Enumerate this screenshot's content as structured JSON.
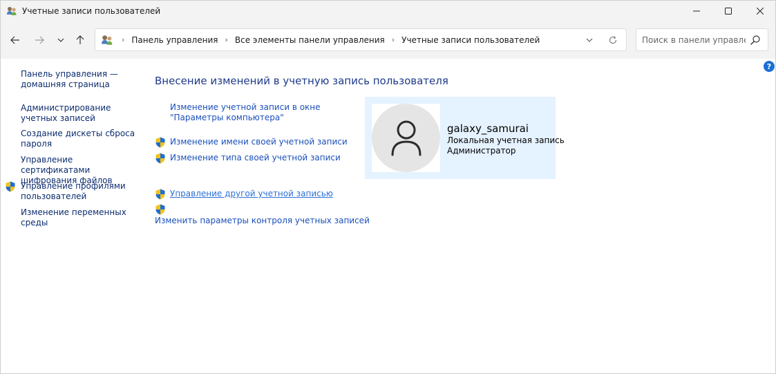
{
  "window": {
    "title": "Учетные записи пользователей"
  },
  "address_bar": {
    "crumbs": [
      "Панель управления",
      "Все элементы панели управления",
      "Учетные записи пользователей"
    ]
  },
  "search": {
    "placeholder": "Поиск в панели управле..."
  },
  "help": {
    "label": "?"
  },
  "sidebar": {
    "items": [
      {
        "label": "Панель управления — домашняя страница",
        "shield": false
      },
      {
        "label": "Администрирование учетных записей",
        "shield": false
      },
      {
        "label": "Создание дискеты сброса пароля",
        "shield": false
      },
      {
        "label": "Управление сертификатами шифрования файлов",
        "shield": false
      },
      {
        "label": "Управление профилями пользователей",
        "shield": true
      },
      {
        "label": "Изменение переменных среды",
        "shield": false
      }
    ]
  },
  "main": {
    "title": "Внесение изменений в учетную запись пользователя",
    "tasks": [
      {
        "label": "Изменение учетной записи в окне \"Параметры компьютера\"",
        "shield": false
      },
      {
        "label": "Изменение имени своей учетной записи",
        "shield": true
      },
      {
        "label": "Изменение типа своей учетной записи",
        "shield": true
      },
      {
        "label": "Управление другой учетной записью",
        "shield": true
      },
      {
        "label": "Изменить параметры контроля учетных записей",
        "shield": true
      }
    ]
  },
  "user": {
    "name": "galaxy_samurai",
    "account_type": "Локальная учетная запись",
    "role": "Администратор"
  },
  "colors": {
    "link": "#1a4fba",
    "sidebar_link": "#0c2c6e",
    "title": "#1e3a8a",
    "card_bg": "#e5f2ff",
    "chrome_bg": "#f3f3f3"
  }
}
